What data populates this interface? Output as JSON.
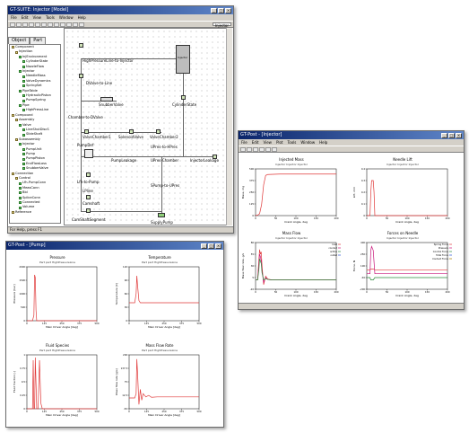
{
  "w1": {
    "title": "GT-SUITE: Injector [Model]",
    "menu": [
      "File",
      "Edit",
      "View",
      "Tools",
      "Window",
      "Help"
    ],
    "tabs": [
      "Object",
      "Part"
    ],
    "combo": "Injector",
    "tree": [
      "Component",
      "Injection",
      "InjEnvironment",
      "CylinderState",
      "NozzleFlow",
      "Injector",
      "NeedleMass",
      "ValveDynamics",
      "SpringSet",
      "PipeTable",
      "HydraulicPiston",
      "PumpSpring",
      "Pipe",
      "HighPressLine",
      "Compound",
      "Assembly",
      "Valve",
      "LineShutDiscS",
      "SlideShaft",
      "Subassembly",
      "Injector",
      "PumpUnit",
      "Pump",
      "PumpPiston",
      "EndFlowLoss",
      "SnubberValve",
      "Connection",
      "Control",
      "Lfh-PumpConn",
      "MeasConn",
      "Bbl",
      "SpliceConn",
      "Connected",
      "Volume",
      "Reference"
    ],
    "status": "For Help, press F1",
    "labels": [
      "HighPressureLine-to-Injector",
      "Injector",
      "DValve-to-Line",
      "SnubberValve",
      "CylinderState",
      "Chamber-to-DValve",
      "ValveChamber1",
      "SolenoidValve",
      "ValveChamber2",
      "PumpDef",
      "UPres-to-HPres",
      "PumpLeakage",
      "UPres-Chamber",
      "InjectorLeakage",
      "Lfh-to-Pump",
      "LPline",
      "SPump-to-UPres",
      "Camshaft",
      "CamShaftSegment",
      "SupplyPump"
    ]
  },
  "w2": {
    "title": "GT-Post - [Injector]",
    "menu": [
      "File",
      "Edit",
      "View",
      "Plot",
      "Tools",
      "Window",
      "Help"
    ],
    "legend_flow": [
      "Inlet",
      "conduit",
      "orifice",
      "outlet"
    ],
    "legend_force": [
      "Spring Force",
      "Pressure",
      "Control Force",
      "Total Force",
      "Contact Force"
    ]
  },
  "w3": {
    "title": "GT-Post - [Pump]"
  },
  "chart_data": [
    {
      "type": "line",
      "title": "Injected Mass",
      "subtitle": "Injector Injector Injector",
      "xlabel": "Crank Angle, deg",
      "ylabel": "Mass, mg",
      "ylim": [
        0,
        500
      ],
      "xlim": [
        0,
        200
      ],
      "x": [
        0,
        5,
        10,
        15,
        20,
        25,
        30,
        60,
        100,
        150,
        200
      ],
      "series": [
        {
          "values": [
            0,
            5,
            20,
            120,
            330,
            430,
            440,
            445,
            445,
            445,
            445
          ]
        }
      ]
    },
    {
      "type": "line",
      "title": "Needle Lift",
      "subtitle": "Injector Injector Injector",
      "xlabel": "Crank Angle, deg",
      "ylabel": "Lift, mm",
      "ylim": [
        0,
        0.4
      ],
      "xlim": [
        0,
        200
      ],
      "x": [
        0,
        8,
        10,
        12,
        14,
        16,
        18,
        20,
        30,
        200
      ],
      "series": [
        {
          "values": [
            0,
            0,
            0.2,
            0.3,
            0.3,
            0.3,
            0.2,
            0,
            0,
            0
          ]
        }
      ]
    },
    {
      "type": "line",
      "title": "Mass Flow",
      "subtitle": "Injector Injector Injector",
      "xlabel": "Crank Angle, deg",
      "ylabel": "Mass flow rate, g/s",
      "ylim": [
        -20,
        80
      ],
      "xlim": [
        0,
        200
      ],
      "x": [
        0,
        5,
        8,
        10,
        12,
        14,
        16,
        20,
        25,
        30,
        40,
        60,
        100,
        200
      ],
      "series": [
        {
          "name": "Inlet",
          "values": [
            0,
            0,
            40,
            65,
            55,
            60,
            30,
            -10,
            8,
            2,
            0,
            0,
            0,
            0
          ]
        },
        {
          "name": "conduit",
          "values": [
            0,
            0,
            30,
            55,
            50,
            40,
            20,
            -5,
            5,
            1,
            0,
            0,
            0,
            0
          ]
        },
        {
          "name": "orifice",
          "values": [
            0,
            0,
            20,
            45,
            40,
            35,
            15,
            0,
            3,
            1,
            0,
            0,
            0,
            0
          ]
        }
      ]
    },
    {
      "type": "line",
      "title": "Forces on Needle",
      "subtitle": "Injector Injector Injector",
      "xlabel": "Crank Angle, deg",
      "ylabel": "Force, N",
      "ylim": [
        -200,
        400
      ],
      "xlim": [
        0,
        200
      ],
      "x": [
        0,
        8,
        10,
        12,
        16,
        20,
        30,
        200
      ],
      "series": [
        {
          "name": "Spring Force",
          "values": [
            50,
            50,
            60,
            60,
            60,
            50,
            50,
            50
          ]
        },
        {
          "name": "Pressure",
          "values": [
            0,
            0,
            300,
            350,
            300,
            0,
            0,
            0
          ]
        },
        {
          "name": "Control Force",
          "values": [
            -50,
            -50,
            -80,
            -80,
            -80,
            -50,
            -50,
            -50
          ]
        }
      ]
    },
    {
      "type": "line",
      "title": "Pressure",
      "subtitle": "Part part HighPressureLine",
      "xlabel": "Main Driver Angle [deg]",
      "ylabel": "Pressure [bar]",
      "ylim": [
        0,
        2000
      ],
      "xlim": [
        0,
        500
      ],
      "x": [
        0,
        40,
        50,
        55,
        60,
        65,
        70,
        80,
        100,
        500
      ],
      "series": [
        {
          "values": [
            0,
            0,
            200,
            1700,
            1600,
            400,
            0,
            0,
            0,
            0
          ]
        }
      ]
    },
    {
      "type": "line",
      "title": "Temperature",
      "subtitle": "Part part HighPressureLine",
      "xlabel": "Main Driver Angle [deg]",
      "ylabel": "Temperature [C]",
      "ylim": [
        0,
        120
      ],
      "xlim": [
        0,
        500
      ],
      "x": [
        0,
        40,
        50,
        55,
        60,
        70,
        80,
        500
      ],
      "series": [
        {
          "values": [
            40,
            40,
            60,
            100,
            80,
            45,
            40,
            40
          ]
        }
      ]
    },
    {
      "type": "line",
      "title": "Fluid Species",
      "subtitle": "Part part HighPressureLine",
      "xlabel": "Main Driver Angle [deg]",
      "ylabel": "Fluid fraction [-]",
      "ylim": [
        0,
        1
      ],
      "xlim": [
        0,
        500
      ],
      "x": [
        0,
        40,
        45,
        50,
        55,
        60,
        70,
        80,
        90,
        100,
        110,
        500
      ],
      "series": [
        {
          "values": [
            0,
            0,
            0.9,
            0,
            0,
            0.95,
            0,
            0,
            0.9,
            0.1,
            0,
            0
          ]
        }
      ]
    },
    {
      "type": "line",
      "title": "Mass Flow Rate",
      "subtitle": "Part part HighPressureLine",
      "xlabel": "Main Driver Angle [deg]",
      "ylabel": "Mass flow rate [g/s]",
      "ylim": [
        -50,
        200
      ],
      "xlim": [
        0,
        500
      ],
      "x": [
        0,
        40,
        50,
        55,
        60,
        70,
        80,
        90,
        100,
        120,
        140,
        160,
        200,
        300,
        500
      ],
      "series": [
        {
          "values": [
            0,
            0,
            20,
            180,
            120,
            -30,
            40,
            -10,
            20,
            5,
            12,
            3,
            5,
            5,
            5
          ]
        }
      ]
    }
  ]
}
